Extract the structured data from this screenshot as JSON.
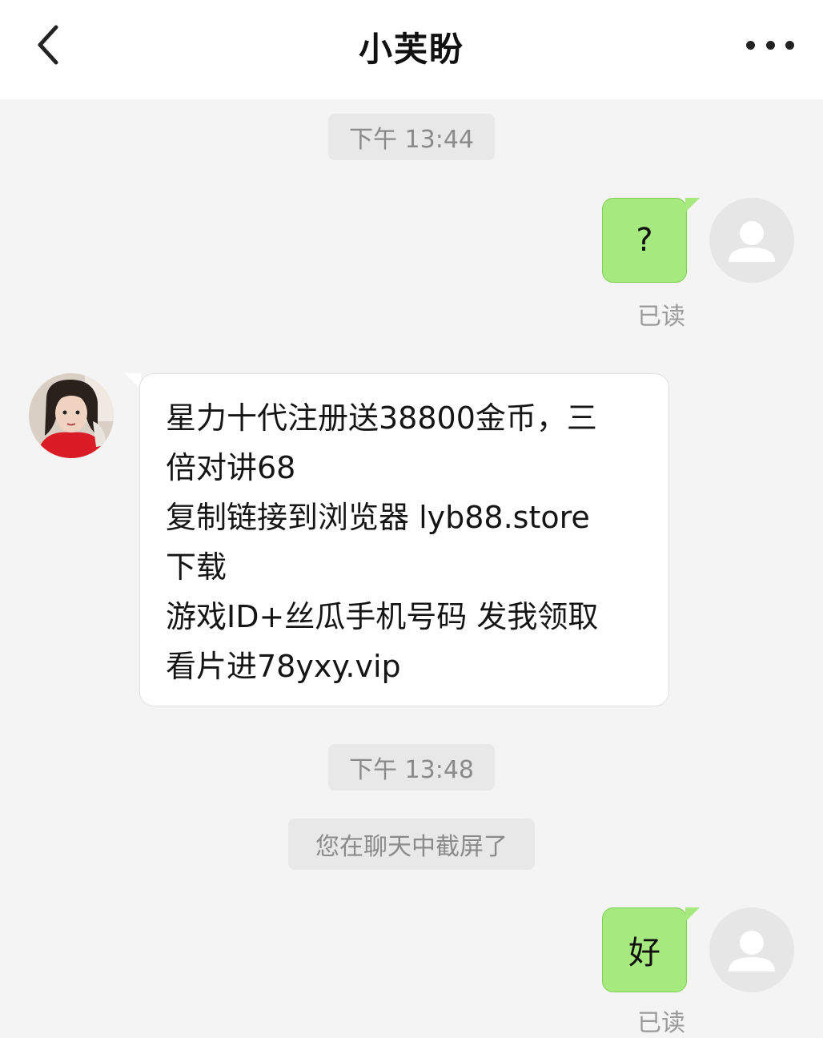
{
  "header": {
    "title": "小芙盼",
    "back_icon": "chevron-left-icon",
    "more_icon": "more-horizontal-icon"
  },
  "messages": [
    {
      "type": "time",
      "text": "下午 13:44"
    },
    {
      "type": "outgoing",
      "text": "?",
      "status": "已读"
    },
    {
      "type": "incoming",
      "lines": [
        "星力十代注册送38800金币，三",
        "倍对讲68",
        "复制链接到浏览器   lyb88.store",
        "下载",
        "游戏ID+丝瓜手机号码 发我领取",
        "看片进78yxy.vip"
      ]
    },
    {
      "type": "time",
      "text": "下午 13:48"
    },
    {
      "type": "system",
      "text": "您在聊天中截屏了"
    },
    {
      "type": "outgoing",
      "text": "好",
      "status": "已读"
    }
  ],
  "colors": {
    "outgoing_bubble": "#a6e97f",
    "incoming_bubble": "#ffffff",
    "background": "#f4f4f4",
    "header_bg": "#ffffff"
  }
}
